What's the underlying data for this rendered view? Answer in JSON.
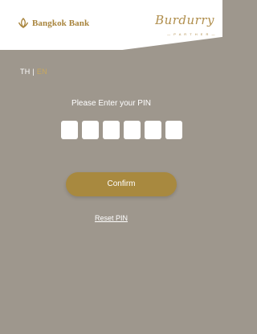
{
  "header": {
    "brand_name": "Bangkok Bank",
    "partner_name": "Burdurry",
    "partner_sub": "— P A R T H E R —"
  },
  "language": {
    "first": "TH",
    "separator": "|",
    "second": "EN",
    "active": "EN"
  },
  "pin": {
    "prompt": "Please Enter your PIN",
    "digit_count": 6
  },
  "actions": {
    "confirm_label": "Confirm",
    "reset_label": "Reset PIN"
  },
  "colors": {
    "background": "#9e978d",
    "gold": "#a8893f",
    "header": "#ffffff"
  },
  "icons": {
    "brand_logo": "lotus-icon"
  }
}
